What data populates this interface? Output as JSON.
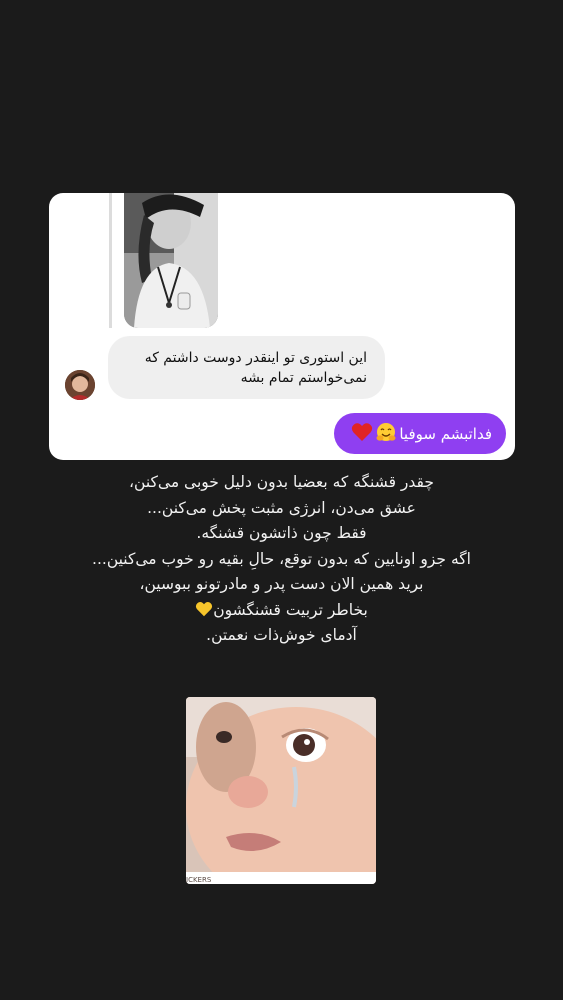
{
  "reply_card": {
    "incoming_message": {
      "line1": "این استوری تو اینقدر دوست داشتم که",
      "line2": "نمی‌خواستم تمام بشه"
    },
    "outgoing_message": {
      "text": "فداتبشم سوفیا"
    },
    "icons": {
      "story_thumbnail": "story-thumbnail-image",
      "sender_avatar": "avatar-image",
      "emoji_1": "hugging-face-emoji",
      "emoji_2": "red-heart-emoji"
    },
    "colors": {
      "outgoing_bubble": "#8f3ff1",
      "incoming_bubble": "#efefef",
      "card_background": "#ffffff"
    }
  },
  "caption": {
    "lines": [
      "چقدر قشنگه که بعضیا بدون دلیل خوبی می‌کنن،",
      "عشق می‌دن، انرژی مثبت پخش می‌کنن...",
      "فقط چون ذاتشون قشنگه.",
      "اگه جزو اونایین که بدون توقع، حالِ بقیه رو خوب می‌کنین...",
      "برید همین الان دست پدر و مادرتونو ببوسین،",
      "بخاطر تربیت قشنگشون",
      "آدمای خوش‌ذات نعمتن."
    ],
    "line6_emoji": "yellow-heart-emoji"
  },
  "sticker": {
    "icon": "crying-baby-sticker",
    "tag": "ICKERS"
  },
  "colors": {
    "page_background": "#1b1b1b",
    "caption_text": "#f2f2f2"
  }
}
